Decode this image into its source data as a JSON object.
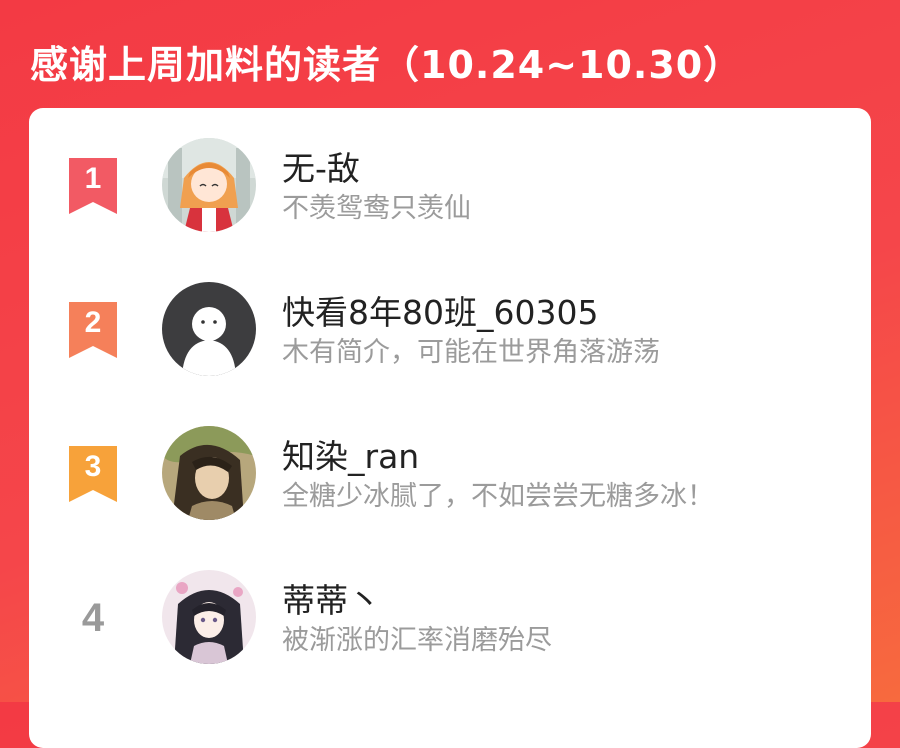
{
  "title": "感谢上周加料的读者（10.24~10.30）",
  "readers": [
    {
      "rank": "1",
      "name": "无-敌",
      "bio": "不羡鸳鸯只羡仙",
      "badge_color": "#f25a64",
      "avatar": "anime-girl-orange-hair-avatar"
    },
    {
      "rank": "2",
      "name": "快看8年80班_60305",
      "bio": "木有简介，可能在世界角落游荡",
      "badge_color": "#f5805a",
      "avatar": "default-ghost-avatar"
    },
    {
      "rank": "3",
      "name": "知染_ran",
      "bio": "全糖少冰腻了，不如尝尝无糖多冰！",
      "badge_color": "#f7a23a",
      "avatar": "painted-portrait-avatar"
    },
    {
      "rank": "4",
      "name": "蒂蒂丶",
      "bio": "被渐涨的汇率消磨殆尽",
      "badge_color": "#9a9a9a",
      "avatar": "anime-girl-dark-hair-avatar"
    }
  ],
  "colors": {
    "header_bg": "#f33a44",
    "card_bg": "#ffffff"
  }
}
